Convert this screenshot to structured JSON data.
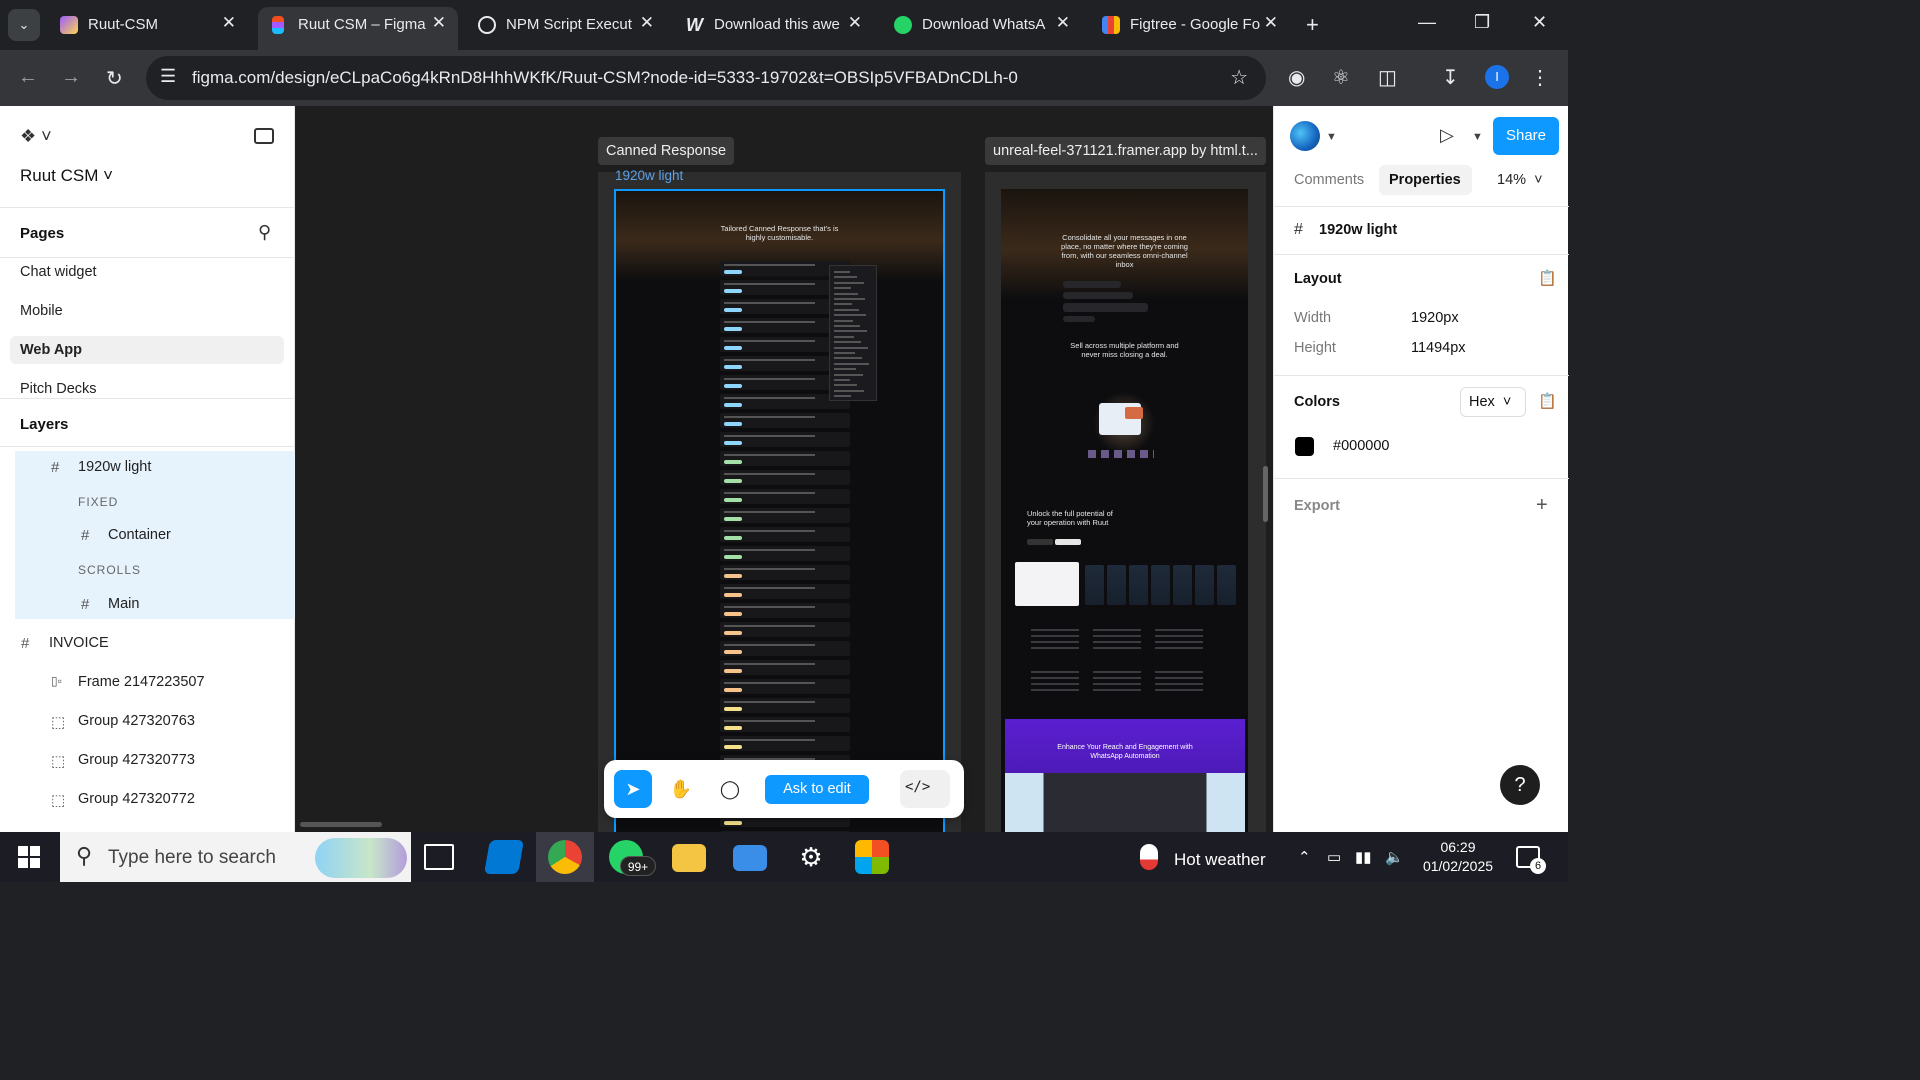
{
  "browser": {
    "tabs": [
      {
        "title": "Ruut-CSM",
        "icon": "vite-icon",
        "active": false
      },
      {
        "title": "Ruut CSM – Figma",
        "icon": "figma-icon",
        "active": true
      },
      {
        "title": "NPM Script Execut",
        "icon": "chatgpt-icon",
        "active": false
      },
      {
        "title": "Download this awe",
        "icon": "webflow-icon",
        "active": false
      },
      {
        "title": "Download WhatsA",
        "icon": "whatsapp-icon",
        "active": false
      },
      {
        "title": "Figtree - Google Fo",
        "icon": "google-fonts-icon",
        "active": false
      }
    ],
    "url": "figma.com/design/eCLpaCo6g4kRnD8HhhWKfK/Ruut-CSM?node-id=5333-19702&t=OBSIp5VFBADnCDLh-0",
    "profile_initial": "I"
  },
  "figma": {
    "file_name": "Ruut CSM",
    "pages_title": "Pages",
    "pages": [
      "Chat widget",
      "Mobile",
      "Web App",
      "Pitch Decks"
    ],
    "selected_page": "Web App",
    "layers_title": "Layers",
    "layers": [
      {
        "label": "1920w light",
        "icon": "frame-icon",
        "indent": 1,
        "selected": true
      },
      {
        "label": "FIXED",
        "caption": true,
        "indent": 2
      },
      {
        "label": "Container",
        "icon": "frame-icon",
        "indent": 3
      },
      {
        "label": "SCROLLS",
        "caption": true,
        "indent": 2
      },
      {
        "label": "Main",
        "icon": "frame-icon",
        "indent": 3
      },
      {
        "label": "INVOICE",
        "icon": "frame-icon",
        "indent": 0
      },
      {
        "label": "Frame 2147223507",
        "icon": "auto-layout-icon",
        "indent": 1
      },
      {
        "label": "Group 427320763",
        "icon": "group-icon",
        "indent": 1
      },
      {
        "label": "Group 427320773",
        "icon": "group-icon",
        "indent": 1
      },
      {
        "label": "Group 427320772",
        "icon": "group-icon",
        "indent": 1
      }
    ],
    "canvas": {
      "frame1_tag": "Canned Response",
      "frame1_sub": "1920w light",
      "frame1_hero": "Tailored Canned Response that's is highly customisable.",
      "frame2_tag": "unreal-feel-371121.framer.app by html.t...",
      "frame2_hero": "Consolidate all your messages in one place, no matter where they're coming from, with our seamless omni-channel inbox",
      "frame2_mid": "Sell across multiple platform and never miss closing a deal.",
      "frame2_unlock": "Unlock the full potential of your operation with Ruut",
      "frame2_banner": "Enhance Your Reach and Engagement with WhatsApp Automation"
    },
    "toolbar": {
      "ask_to_edit": "Ask to edit",
      "code": "</>"
    },
    "right": {
      "share": "Share",
      "tab_comments": "Comments",
      "tab_properties": "Properties",
      "zoom": "14%",
      "selection": "1920w light",
      "layout_title": "Layout",
      "width_label": "Width",
      "width_value": "1920px",
      "height_label": "Height",
      "height_value": "11494px",
      "colors_title": "Colors",
      "color_format": "Hex",
      "color_value": "#000000",
      "export_title": "Export",
      "help": "?"
    }
  },
  "taskbar": {
    "search_placeholder": "Type here to search",
    "whatsapp_badge": "99+",
    "weather": "Hot weather",
    "time": "06:29",
    "date": "01/02/2025",
    "notifications": "6"
  }
}
